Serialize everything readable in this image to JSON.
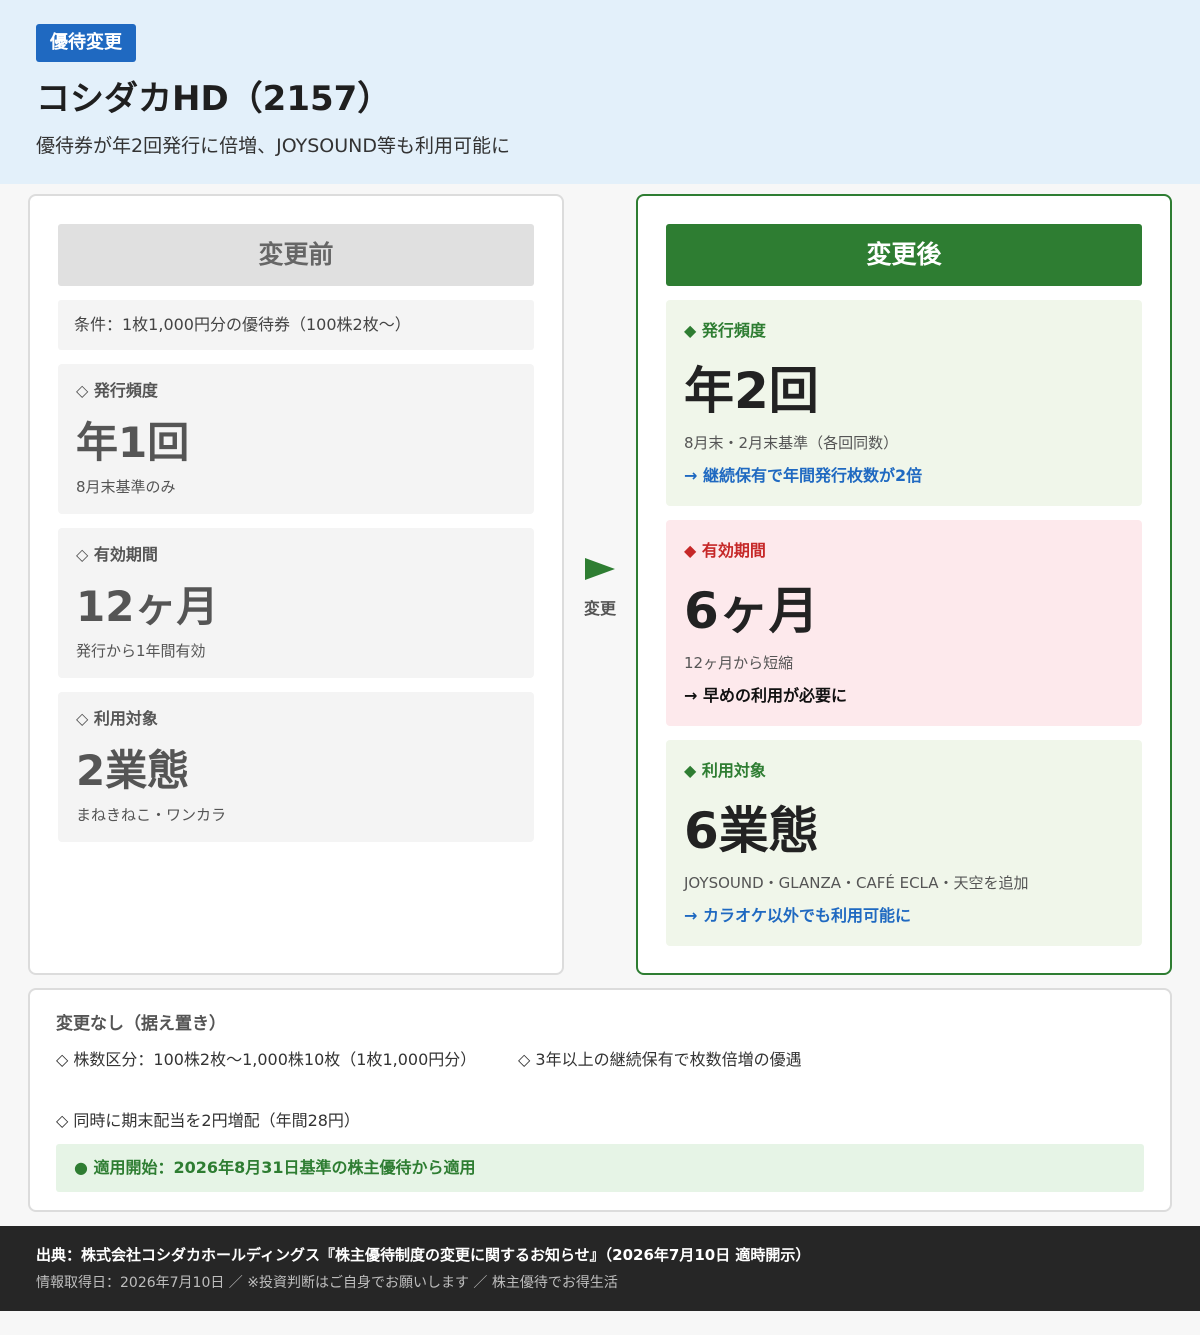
{
  "header": {
    "badge": "優待変更",
    "title": "コシダカHD（2157）",
    "subtitle": "優待券が年2回発行に倍増、JOYSOUND等も利用可能に"
  },
  "before": {
    "heading": "変更前",
    "condition": "条件：1枚1,000円分の優待券（100株2枚〜）",
    "cards": [
      {
        "label": "◇ 発行頻度",
        "value": "年1回",
        "note": "8月末基準のみ"
      },
      {
        "label": "◇ 有効期間",
        "value": "12ヶ月",
        "note": "発行から1年間有効"
      },
      {
        "label": "◇ 利用対象",
        "value": "2業態",
        "note": "まねきねこ・ワンカラ"
      }
    ]
  },
  "arrow": {
    "label": "変更",
    "icon": "triangle-right-icon"
  },
  "after": {
    "heading": "変更後",
    "cards": [
      {
        "label": "◆ 発行頻度",
        "value": "年2回",
        "note": "8月末・2月末基準（各回同数）",
        "emphasis": "→ 継続保有で年間発行枚数が2倍"
      },
      {
        "label": "◆ 有効期間",
        "value": "6ヶ月",
        "note": "12ヶ月から短縮",
        "emphasis": "→ 早めの利用が必要に"
      },
      {
        "label": "◆ 利用対象",
        "value": "6業態",
        "note": "JOYSOUND・GLANZA・CAFÉ ECLA・天空を追加",
        "emphasis": "→ カラオケ以外でも利用可能に"
      }
    ]
  },
  "unchanged": {
    "title": "変更なし（据え置き）",
    "items": [
      "◇ 株数区分：100株2枚〜1,000株10枚（1枚1,000円分）",
      "◇ 3年以上の継続保有で枚数倍増の優遇",
      "◇ 同時に期末配当を2円増配（年間28円）"
    ],
    "apply": "● 適用開始：2026年8月31日基準の株主優待から適用"
  },
  "footer": {
    "source": "出典：株式会社コシダカホールディングス『株主優待制度の変更に関するお知らせ』（2026年7月10日 適時開示）",
    "info": "情報取得日：2026年7月10日 ／ ※投資判断はご自身でお願いします ／ 株主優待でお得生活"
  },
  "colors": {
    "brand_blue": "#1f69c1",
    "header_bg": "#e3f0fa",
    "after_green": "#2e7d32",
    "green_card_bg": "#f0f6ea",
    "pink_card_bg": "#fde9ec",
    "warning_red": "#c62828",
    "footer_bg": "#262626"
  }
}
